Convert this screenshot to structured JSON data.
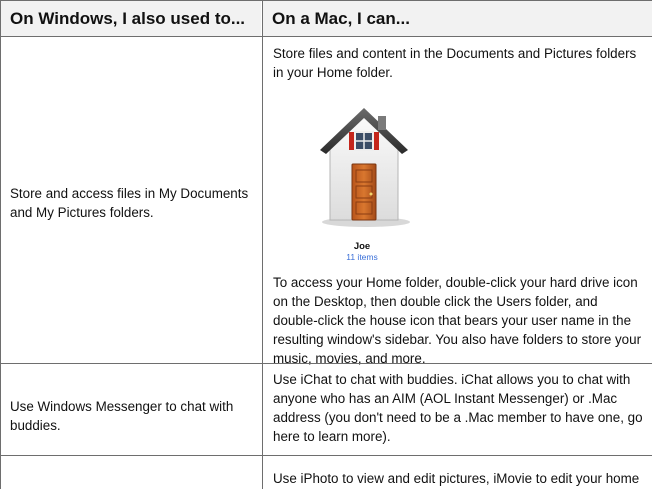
{
  "header": {
    "col1": "On Windows, I also used to...",
    "col2": "On a Mac, I can..."
  },
  "rows": [
    {
      "windows": "Store and access files in My Documents and My Pictures folders.",
      "mac_lines": [
        "Store files and content in the Documents and Pictures folders",
        "in your Home folder."
      ],
      "icon": {
        "name": "home-folder-icon",
        "label": "Joe",
        "sublabel": "11 items"
      },
      "mac_detail_lines": [
        "To access your Home folder, double-click your hard drive icon",
        "on the Desktop, then double click the Users folder, and",
        "double-click the house icon that bears your user name in the",
        "resulting window's sidebar. You also have folders to store your",
        "music, movies, and more."
      ]
    },
    {
      "windows_lines": [
        "Use Windows Messenger to chat with",
        "buddies."
      ],
      "mac_lines": [
        "Use iChat to chat with buddies. iChat allows you to chat with",
        "anyone who has an AIM (AOL Instant Messenger) or .Mac",
        "address (you don't need to be a .Mac member to have one, go",
        "here to learn more)."
      ]
    },
    {
      "windows": "",
      "mac_lines": [
        "Use iPhoto to view and edit pictures, iMovie to edit your home"
      ]
    }
  ],
  "colors": {
    "header_bg": "#f2f2f2",
    "border": "#6e6e6e",
    "sublabel": "#3a6fd8"
  }
}
